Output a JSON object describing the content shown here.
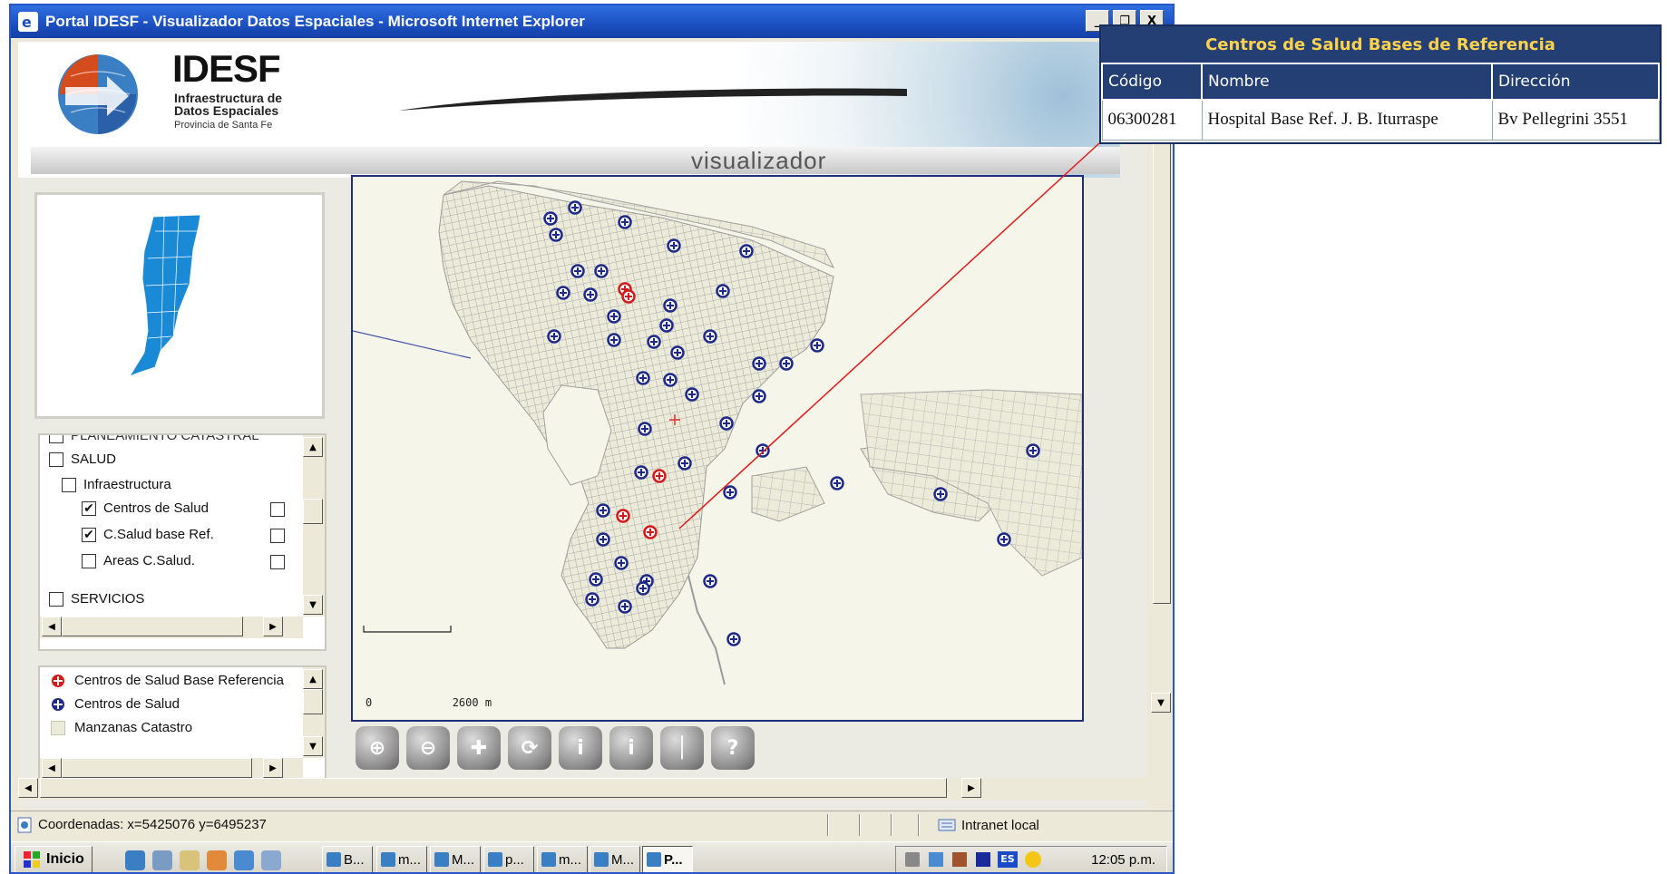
{
  "window": {
    "title": "Portal IDESF - Visualizador Datos Espaciales - Microsoft Internet Explorer",
    "buttons": [
      "_",
      "❐",
      "X"
    ]
  },
  "header": {
    "brand": "IDESF",
    "sub1": "Infraestructura de",
    "sub2": "Datos Espaciales",
    "sub3": "Provincia de Santa Fe",
    "visualizador": "visualizador"
  },
  "layers": {
    "cut_top": "PLANEAMIENTO CATASTRAL",
    "items": [
      {
        "label": "SALUD",
        "checked": false
      },
      {
        "label": "Infraestructura",
        "checked": false
      },
      {
        "label": "Centros de Salud",
        "checked": true
      },
      {
        "label": "C.Salud base Ref.",
        "checked": true
      },
      {
        "label": "Areas C.Salud.",
        "checked": false
      },
      {
        "label": "SERVICIOS",
        "checked": false
      }
    ],
    "check_mark": "✔"
  },
  "legend": {
    "items": [
      {
        "label": "Centros de Salud Base Referencia",
        "color": "#d31a1a"
      },
      {
        "label": "Centros de Salud",
        "color": "#1d2a8a"
      },
      {
        "label": "Manzanas Catastro",
        "color": "#ecebd9"
      }
    ]
  },
  "map": {
    "scale_start": "0",
    "scale_label": "2600 m",
    "colors": {
      "background": "#f5f5e9",
      "streets": "#b9b9b9",
      "health_center": "#1d2a8a",
      "reference_center": "#d31a1a"
    }
  },
  "tools": [
    {
      "name": "zoom-in-tool",
      "glyph": "⊕"
    },
    {
      "name": "zoom-out-tool",
      "glyph": "⊖"
    },
    {
      "name": "pan-tool",
      "glyph": "✚"
    },
    {
      "name": "refresh-tool",
      "glyph": "⟳"
    },
    {
      "name": "identify-tool",
      "glyph": "i"
    },
    {
      "name": "info-tool",
      "glyph": "i"
    },
    {
      "name": "measure-tool",
      "glyph": "│"
    },
    {
      "name": "help-tool",
      "glyph": "?"
    }
  ],
  "status": {
    "coords": "Coordenadas: x=5425076    y=6495237",
    "zone": "Intranet local"
  },
  "taskbar": {
    "start": "Inicio",
    "tasks": [
      "B...",
      "m...",
      "M...",
      "p...",
      "m...",
      "M...",
      "P..."
    ],
    "clock": "12:05 p.m."
  },
  "popup": {
    "title": "Centros de Salud Bases de Referencia",
    "columns": [
      "Código",
      "Nombre",
      "Dirección"
    ],
    "rows": [
      [
        "06300281",
        "Hospital Base Ref. J. B. Iturraspe",
        "Bv Pellegrini 3551"
      ]
    ]
  }
}
